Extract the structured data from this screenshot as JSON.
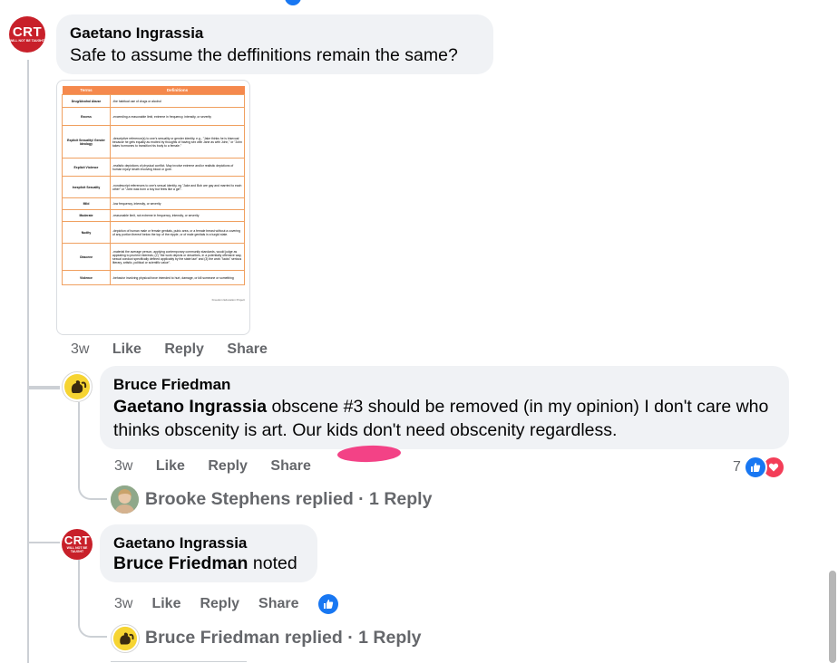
{
  "comments": [
    {
      "author": "Gaetano Ingrassia",
      "text": "Safe to assume the deffinitions remain the same?",
      "time": "3w",
      "actions": [
        "Like",
        "Reply",
        "Share"
      ]
    },
    {
      "author": "Bruce Friedman",
      "mention": "Gaetano Ingrassia",
      "text": " obscene #3 should be removed (in my opinion) I don't care who thinks obscenity is art. Our kids don't need obscenity regardless.",
      "time": "3w",
      "actions": [
        "Like",
        "Reply",
        "Share"
      ],
      "reaction_count": "7"
    },
    {
      "author": "Gaetano Ingrassia",
      "mention": "Bruce Friedman",
      "text": " noted",
      "time": "3w",
      "actions": [
        "Like",
        "Reply",
        "Share"
      ]
    }
  ],
  "replies": [
    {
      "name": "Brooke Stephens",
      "text": "Brooke Stephens replied · 1 Reply"
    },
    {
      "name": "Bruce Friedman",
      "text": "Bruce Friedman replied · 1 Reply"
    }
  ],
  "avatar_crt": {
    "big": "CRT",
    "small": "WILL NOT BE TAUGHT"
  },
  "attachment": {
    "headers": [
      "Terms",
      "Definitions"
    ],
    "rows": [
      [
        "Drug/Alcohol Abuse",
        "-the habitual use of drugs or alcohol"
      ],
      [
        "Excess",
        "-exceeding a reasonable limit, extreme in frequency, intensity, or severity"
      ],
      [
        "Explicit Sexuality/ Gender Ideology",
        "-descriptive reference(s) to one's sexuality or gender identity, e.g., \"Jake thinks he is bisexual because he gets equally as excited by thoughts of having sex with Jane as with John,\" or \"John takes hormones to transition his body to a female.\""
      ],
      [
        "Explicit Violence",
        "-realistic depictions of physical conflict. May involve extreme and/or realistic depictions of human injury/ death involving blood or gore."
      ],
      [
        "Inexplicit Sexuality",
        "-nondescript references to one's sexual identity, eg \"Jake and Bob are gay and married to each other\" or \"John was born a boy but feels like a girl\"."
      ],
      [
        "Mild",
        "-low frequency, intensity, or severity"
      ],
      [
        "Moderate",
        "-reasonable limit, not extreme in frequency, intensity, or severity"
      ],
      [
        "Nudity",
        "-depiction of human male or female genitals, pubic area, or a female breast without a covering of any portion thereof below the top of the nipple, or of male genitals in a turgid state."
      ],
      [
        "Obscene",
        "-material the average person, applying contemporary community standards, would judge as appealing to prurient interests; (2) \"the work depicts or describes, in a potentially offensive way, sexual conduct specifically defined applicably by the state law\" and (3) the work \"lacks\" serious literary, artistic, political or scientific value\"."
      ],
      [
        "Violence",
        "-behavior involving physical force intended to hurt, damage, or kill someone or something"
      ]
    ],
    "footer": "Freedom Education Project"
  },
  "colors": {
    "like_blue": "#1877f2",
    "love_red": "#f33e58",
    "highlight_pink": "#f2387f"
  }
}
